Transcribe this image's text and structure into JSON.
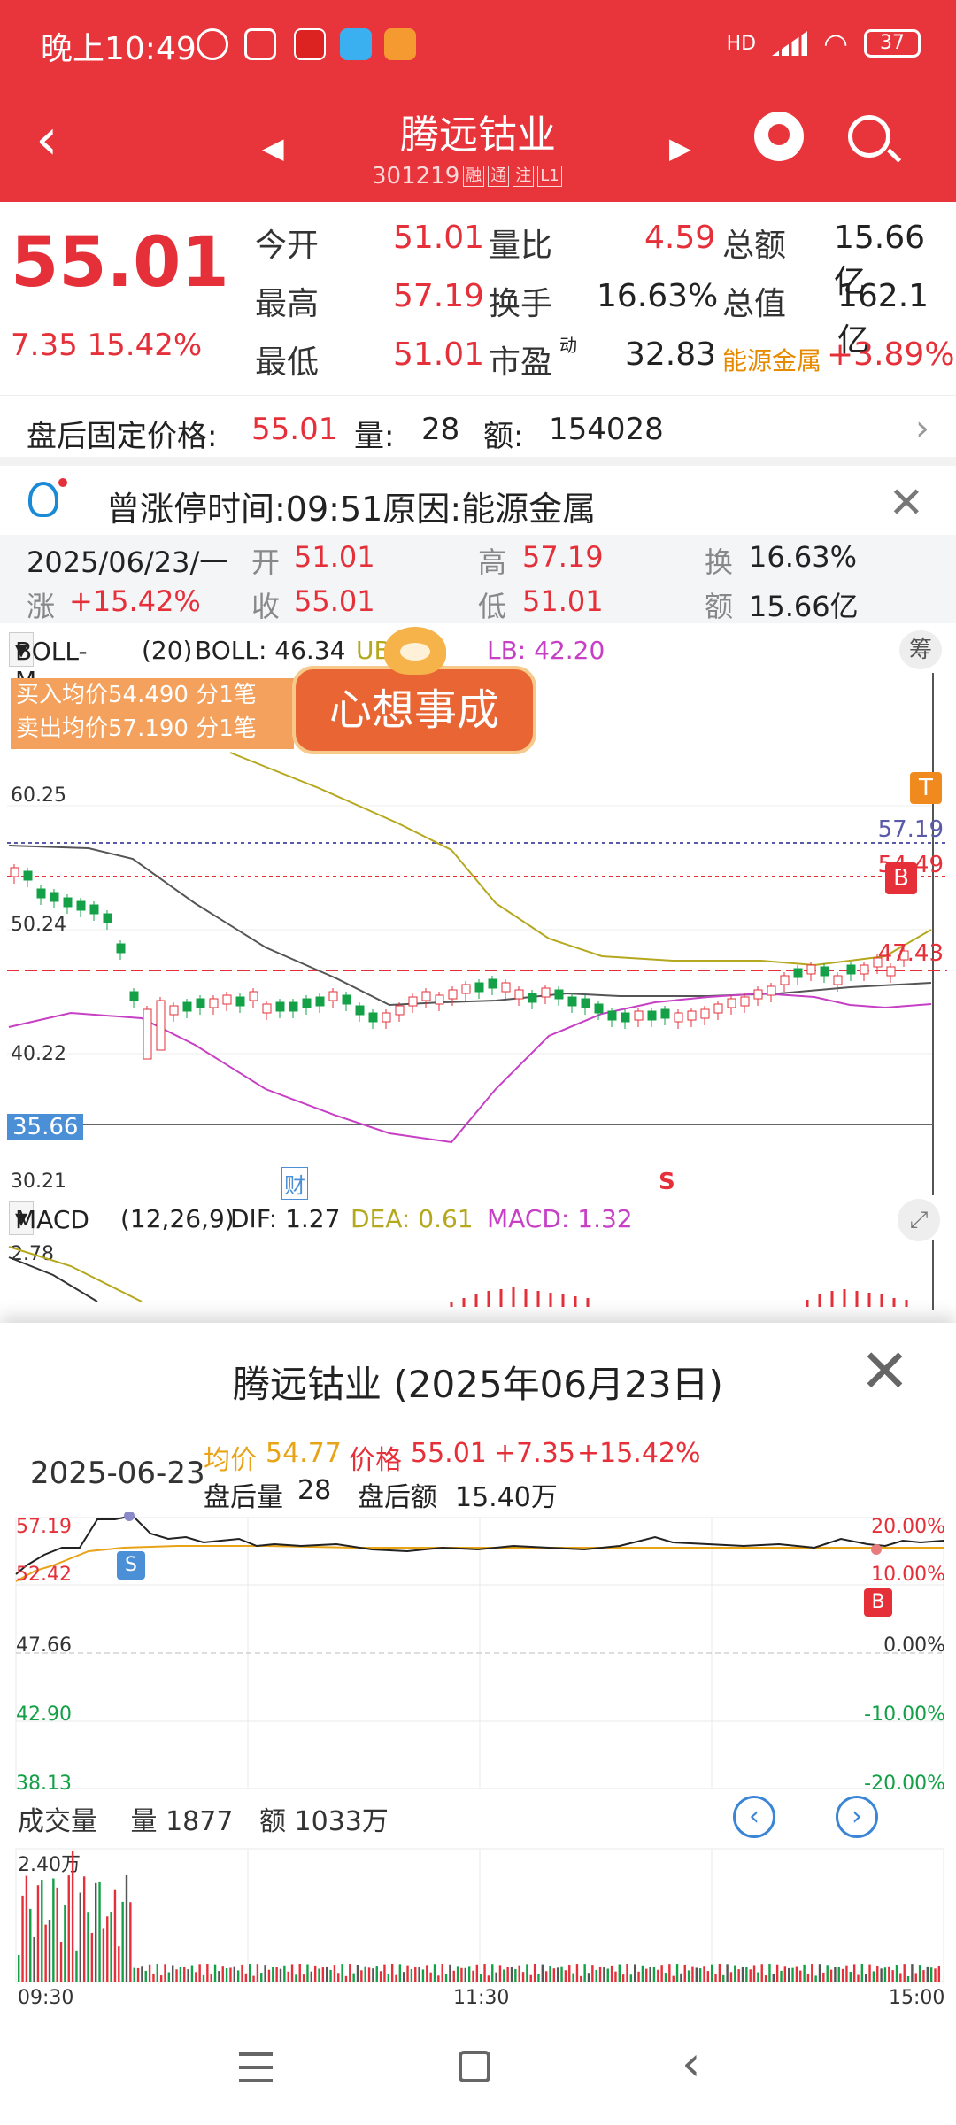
{
  "status_bar": {
    "time": "晚上10:49",
    "battery": "37",
    "network": "HD"
  },
  "header": {
    "stock_name": "腾远钴业",
    "stock_code": "301219",
    "tags": [
      "融",
      "通",
      "注",
      "L1"
    ]
  },
  "quote": {
    "price": "55.01",
    "change": "7.35",
    "change_pct": "15.42%",
    "open_label": "今开",
    "open": "51.01",
    "high_label": "最高",
    "high": "57.19",
    "low_label": "最低",
    "low": "51.01",
    "vol_ratio_label": "量比",
    "vol_ratio": "4.59",
    "turnover_label": "换手",
    "turnover": "16.63%",
    "pe_label": "市盈",
    "pe_sup": "动",
    "pe": "32.83",
    "amount_label": "总额",
    "amount": "15.66亿",
    "mktcap_label": "总值",
    "mktcap": "162.1亿",
    "sector": "能源金属",
    "sector_pct": "+3.89%"
  },
  "after_hours": {
    "label": "盘后固定价格:",
    "price": "55.01",
    "vol_label": "量:",
    "vol": "28",
    "amt_label": "额:",
    "amt": "154028"
  },
  "limit_up": {
    "text": "曾涨停时间:09:51原因:能源金属"
  },
  "day_info": {
    "date": "2025/06/23/一",
    "open_label": "开",
    "open": "51.01",
    "high_label": "高",
    "high": "57.19",
    "turn_label": "换",
    "turn": "16.63%",
    "chg_label": "涨",
    "chg": "+15.42%",
    "close_label": "收",
    "close": "55.01",
    "low_label": "低",
    "low": "51.01",
    "amt_label": "额",
    "amt": "15.66亿"
  },
  "kline": {
    "indicator": "BOLL-M",
    "params": "(20)",
    "boll": "BOLL: 46.34",
    "ub": "UB: 48",
    "lb": "LB: 42.20",
    "chou": "筹",
    "buy_avg": "买入均价54.490 分1笔",
    "sell_avg": "卖出均价57.190 分1笔",
    "banner": "心想事成",
    "axis": [
      "60.25",
      "50.24",
      "40.22",
      "35.66",
      "30.21"
    ],
    "marker_T": "T",
    "marker_B": "B",
    "line_5719": "57.19",
    "line_5449": "54.49",
    "line_4743": "47.43",
    "cai": "财",
    "s_marker": "S"
  },
  "macd": {
    "indicator": "MACD",
    "params": "(12,26,9)",
    "dif": "DIF: 1.27",
    "dea": "DEA: 0.61",
    "macd": "MACD: 1.32",
    "axis_top": "2.78"
  },
  "sheet": {
    "title": "腾远钴业 (2025年06月23日)",
    "date": "2025-06-23",
    "avg_label": "均价",
    "avg": "54.77",
    "price_label": "价格",
    "price": "55.01",
    "chg": "+7.35",
    "chg_pct": "+15.42%",
    "ah_vol_label": "盘后量",
    "ah_vol": "28",
    "ah_amt_label": "盘后额",
    "ah_amt": "15.40万",
    "left_axis": [
      "57.19",
      "52.42",
      "47.66",
      "42.90",
      "38.13"
    ],
    "right_axis": [
      "20.00%",
      "10.00%",
      "0.00%",
      "-10.00%",
      "-20.00%"
    ],
    "marker_S": "S",
    "marker_B": "B",
    "vol_title": "成交量",
    "vol_label": "量",
    "vol": "1877",
    "amt_label": "额",
    "amt": "1033万",
    "vol_axis": "2.40万",
    "times": [
      "09:30",
      "11:30",
      "15:00"
    ]
  },
  "colors": {
    "brand": "#e8343b",
    "up": "#e5303a",
    "down": "#13a046",
    "avg_line": "#e8a317",
    "boll_mid": "#b5a81e",
    "boll_lb": "#c63fc4"
  }
}
